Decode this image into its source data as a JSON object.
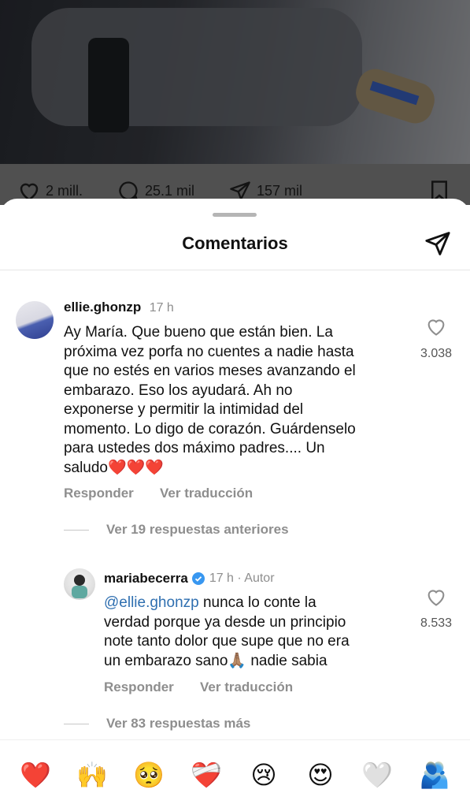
{
  "post": {
    "likes": "2 mill.",
    "comments": "25.1 mil",
    "shares": "157 mil"
  },
  "sheet": {
    "title": "Comentarios"
  },
  "comments": [
    {
      "username": "ellie.ghonzp",
      "time": "17 h",
      "text_lines": [
        "Ay María. Que bueno que están bien. La",
        "próxima vez porfa no cuentes a nadie hasta",
        "que no estés en varios meses avanzando el",
        "embarazo. Eso los ayudará. Ah no",
        "exponerse y permitir la intimidad del",
        "momento. Lo digo de corazón. Guárdenselo",
        "para ustedes dos máximo padres.... Un",
        "saludo❤️❤️❤️"
      ],
      "like_count": "3.038",
      "reply_label": "Responder",
      "translate_label": "Ver traducción",
      "thread_label": "Ver 19 respuestas anteriores"
    },
    {
      "username": "mariabecerra",
      "time": "17 h · Autor",
      "mention": "@ellie.ghonzp",
      "text_first_rest": "nunca lo conte la",
      "text_lines": [
        "verdad porque ya desde un principio",
        "note tanto dolor que supe que no era",
        "un embarazo sano🙏🏽 nadie sabia"
      ],
      "like_count": "8.533",
      "reply_label": "Responder",
      "translate_label": "Ver traducción",
      "thread_label": "Ver 83 respuestas más"
    }
  ],
  "reactions": [
    "❤️",
    "🙌",
    "🥺",
    "❤️‍🩹",
    "😢",
    "😍",
    "🤍",
    "🫂"
  ],
  "colors": {
    "mention": "#2f6fb0",
    "verified": "#3897f0",
    "muted": "#8e8e8e"
  }
}
